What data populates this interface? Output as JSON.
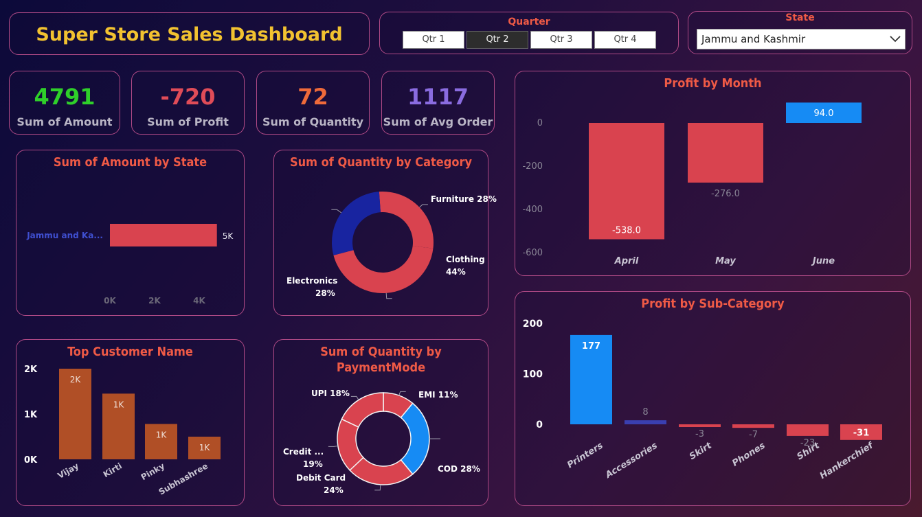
{
  "header": {
    "title": "Super Store Sales Dashboard"
  },
  "quarter_slicer": {
    "title": "Quarter",
    "options": [
      "Qtr 1",
      "Qtr 2",
      "Qtr 3",
      "Qtr 4"
    ],
    "selected": "Qtr 2"
  },
  "state_slicer": {
    "title": "State",
    "selected": "Jammu and Kashmir"
  },
  "kpis": [
    {
      "value": "4791",
      "label": "Sum of Amount",
      "color": "#2fcf2a"
    },
    {
      "value": "-720",
      "label": "Sum of Profit",
      "color": "#e04c58"
    },
    {
      "value": "72",
      "label": "Sum of Quantity",
      "color": "#ef6a3a"
    },
    {
      "value": "1117",
      "label": "Sum of Avg Order",
      "color": "#8a6ce0"
    }
  ],
  "colors": {
    "red": "#d9434f",
    "blue": "#168bf4",
    "navy": "#1824a0",
    "orange": "#b04f26",
    "indigo": "#3a3fb0"
  },
  "chart_data": [
    {
      "id": "amount_by_state",
      "type": "bar",
      "orientation": "horizontal",
      "title": "Sum of Amount by State",
      "categories": [
        "Jammu and Ka..."
      ],
      "values": [
        4791
      ],
      "value_labels": [
        "5K"
      ],
      "xticks": [
        "0K",
        "2K",
        "4K"
      ],
      "xlim": [
        0,
        5000
      ]
    },
    {
      "id": "quantity_by_category",
      "type": "pie",
      "donut": true,
      "title": "Sum of Quantity by Category",
      "slices": [
        {
          "label": "Furniture",
          "percent": 28,
          "display": "Furniture 28%"
        },
        {
          "label": "Clothing",
          "percent": 44,
          "display": "Clothing 44%"
        },
        {
          "label": "Electronics",
          "percent": 28,
          "display": "Electronics 28%"
        }
      ]
    },
    {
      "id": "top_customer",
      "type": "bar",
      "title": "Top Customer Name",
      "categories": [
        "Vijay",
        "Kirti",
        "Pinky",
        "Subhashree"
      ],
      "values": [
        2000,
        1450,
        780,
        500
      ],
      "value_labels": [
        "2K",
        "1K",
        "1K",
        "1K"
      ],
      "yticks": [
        "0K",
        "1K",
        "2K"
      ],
      "ylim": [
        0,
        2000
      ]
    },
    {
      "id": "quantity_by_paymentmode",
      "type": "pie",
      "donut": true,
      "title": "Sum of Quantity by PaymentMode",
      "slices": [
        {
          "label": "EMI",
          "percent": 11,
          "display": "EMI 11%"
        },
        {
          "label": "COD",
          "percent": 28,
          "display": "COD 28%"
        },
        {
          "label": "Debit Card",
          "percent": 24,
          "display": "Debit Card 24%"
        },
        {
          "label": "Credit ...",
          "percent": 19,
          "display": "Credit ... 19%"
        },
        {
          "label": "UPI",
          "percent": 18,
          "display": "UPI 18%"
        }
      ]
    },
    {
      "id": "profit_by_month",
      "type": "bar",
      "title": "Profit by Month",
      "categories": [
        "April",
        "May",
        "June"
      ],
      "values": [
        -538.0,
        -276.0,
        94.0
      ],
      "value_labels": [
        "-538.0",
        "-276.0",
        "94.0"
      ],
      "yticks": [
        "0",
        "-200",
        "-400",
        "-600"
      ],
      "ylim": [
        -600,
        100
      ]
    },
    {
      "id": "profit_by_subcategory",
      "type": "bar",
      "title": "Profit by Sub-Category",
      "categories": [
        "Printers",
        "Accessories",
        "Skirt",
        "Phones",
        "Shirt",
        "Hankerchief"
      ],
      "values": [
        177,
        8,
        -3,
        -7,
        -23,
        -31
      ],
      "value_labels": [
        "177",
        "8",
        "-3",
        "-7",
        "-23",
        "-31"
      ],
      "yticks": [
        "200",
        "100",
        "0"
      ],
      "ylim": [
        -40,
        200
      ]
    }
  ]
}
